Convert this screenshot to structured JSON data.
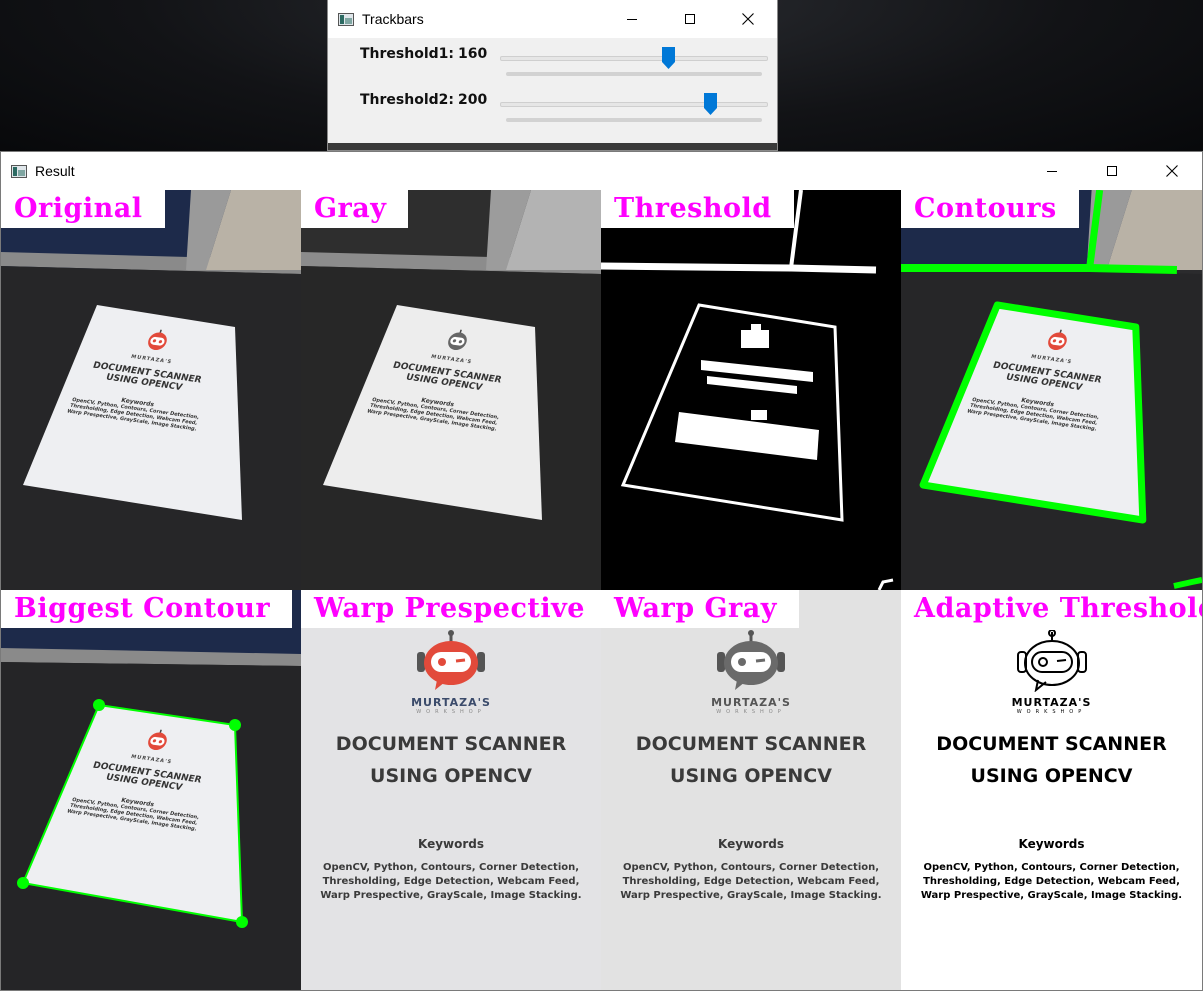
{
  "trackbars": {
    "window_title": "Trackbars",
    "sliders": [
      {
        "label": "Threshold1:",
        "value": "160",
        "fraction": 0.627
      },
      {
        "label": "Threshold2:",
        "value": "200",
        "fraction": 0.784
      }
    ]
  },
  "result": {
    "window_title": "Result",
    "panels": [
      "Original",
      "Gray",
      "Threshold",
      "Contours",
      "Biggest Contour",
      "Warp Prespective",
      "Warp Gray",
      "Adaptive Threshold"
    ]
  },
  "document": {
    "brand": "MURTAZA'S",
    "brand_sub": "WORKSHOP",
    "title_line1": "DOCUMENT SCANNER",
    "title_line2": "USING OPENCV",
    "keywords_head": "Keywords",
    "keywords_line1": "OpenCV, Python, Contours, Corner Detection,",
    "keywords_line2": "Thresholding, Edge Detection, Webcam Feed,",
    "keywords_line3": "Warp Prespective, GrayScale, Image Stacking."
  },
  "colors": {
    "label_text": "#ff00ff",
    "contour": "#00ff00",
    "slider_thumb": "#0078d7",
    "logo_red": "#e24a3b",
    "logo_gray": "#666666"
  },
  "icons": {
    "window_icon": "window-app-icon",
    "minimize": "minimize-icon",
    "maximize": "maximize-icon",
    "close": "close-icon"
  }
}
